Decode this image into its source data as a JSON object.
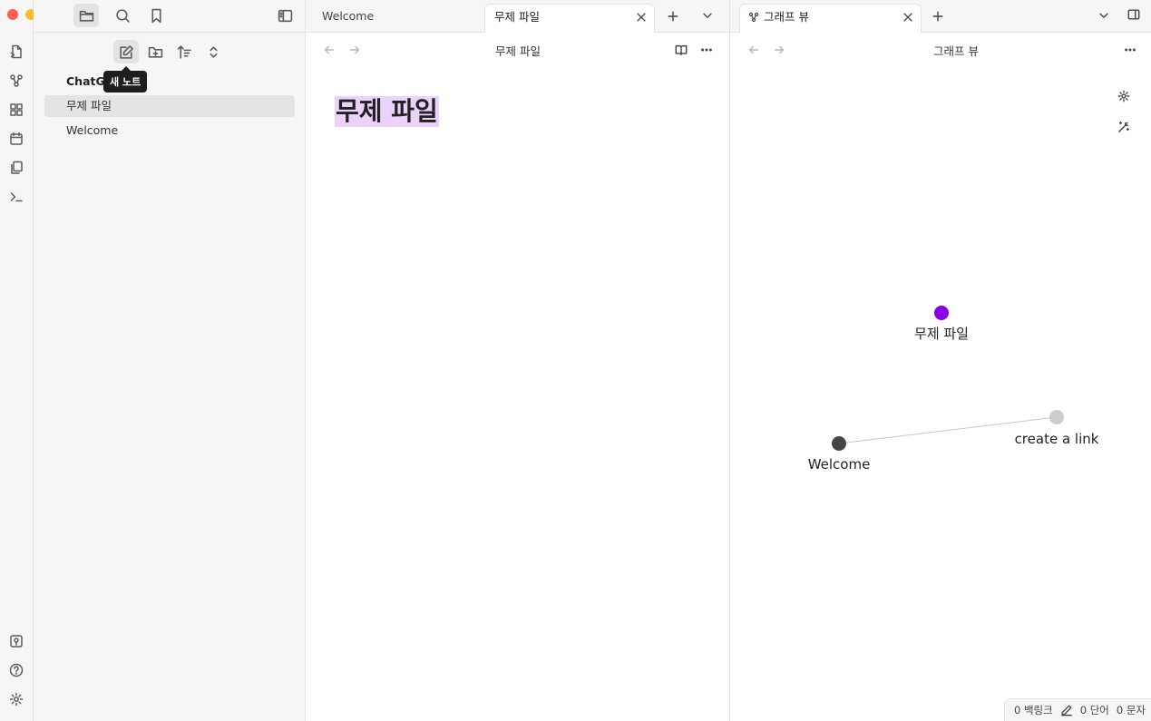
{
  "sidebar": {
    "vault_name": "ChatG",
    "tooltip": "새 노트",
    "files": [
      {
        "name": "무제 파일",
        "selected": true
      },
      {
        "name": "Welcome",
        "selected": false
      }
    ]
  },
  "editor": {
    "tabs": [
      {
        "label": "Welcome",
        "active": false
      },
      {
        "label": "무제 파일",
        "active": true
      }
    ],
    "view_title": "무제 파일",
    "note_title": "무제 파일"
  },
  "graph": {
    "tab_label": "그래프 뷰",
    "view_title": "그래프 뷰",
    "nodes": [
      {
        "id": "untitled",
        "label": "무제 파일",
        "color": "#8a00e6"
      },
      {
        "id": "welcome",
        "label": "Welcome",
        "color": "#444444"
      },
      {
        "id": "create",
        "label": "create a link",
        "color": "#cccccc"
      }
    ],
    "edges": [
      [
        "welcome",
        "create"
      ]
    ]
  },
  "statusbar": {
    "backlinks": "0 백링크",
    "words": "0 단어",
    "chars": "0 문자"
  },
  "colors": {
    "accent": "#8a00e6",
    "highlight": "#ead2fb",
    "traffic_red": "#fe5f57",
    "traffic_yellow": "#febc2e",
    "traffic_green": "#28c840"
  }
}
